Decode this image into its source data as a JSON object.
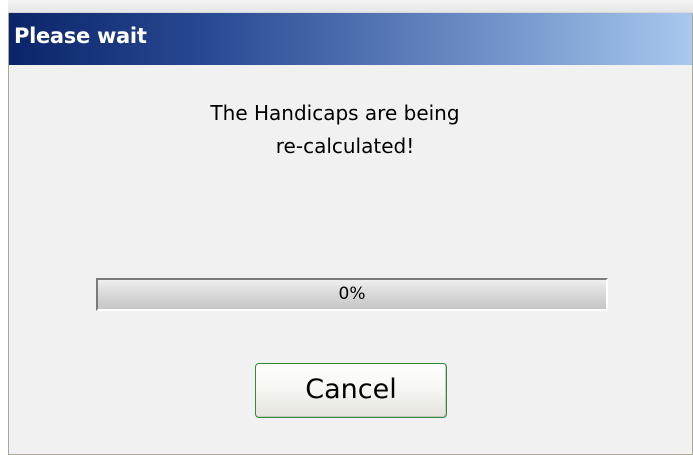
{
  "window": {
    "title": "Please wait"
  },
  "message": {
    "line1": "The Handicaps are being",
    "line2": "re-calculated!"
  },
  "progress": {
    "value_percent": 0,
    "label": "0%"
  },
  "buttons": {
    "cancel_label": "Cancel"
  },
  "colors": {
    "titlebar_start": "#0b2469",
    "titlebar_end": "#a8c8ee",
    "dialog_background": "#f1f1f1",
    "button_border": "#2f8a3c"
  }
}
